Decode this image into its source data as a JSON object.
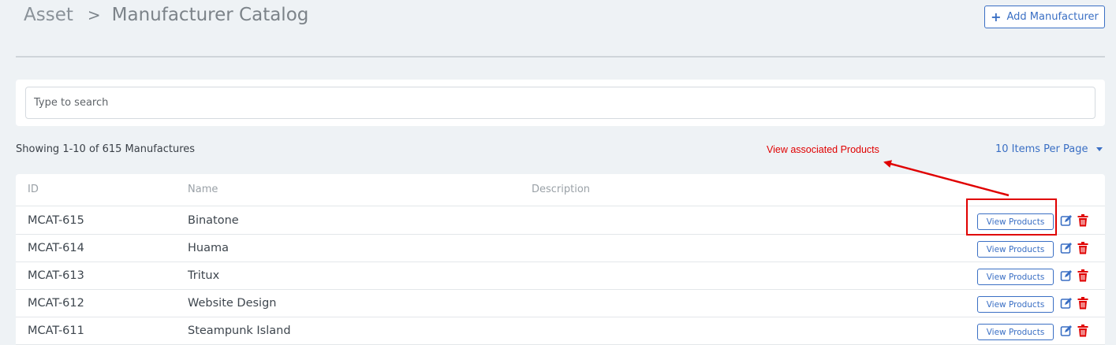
{
  "header": {
    "breadcrumb_root": "Asset",
    "breadcrumb_separator": ">",
    "title": "Manufacturer Catalog",
    "add_button_label": "Add Manufacturer",
    "add_button_icon": "plus-icon"
  },
  "search": {
    "placeholder": "Type to search",
    "value": ""
  },
  "summary": {
    "showing_text": "Showing 1-10 of 615 Manufactures",
    "items_per_page": "10 Items Per Page"
  },
  "annotation": {
    "text": "View associated Products",
    "color": "#e00000"
  },
  "table": {
    "columns": [
      "ID",
      "Name",
      "Description"
    ],
    "rows": [
      {
        "id": "MCAT-615",
        "name": "Binatone",
        "description": "",
        "action_label": "View Products"
      },
      {
        "id": "MCAT-614",
        "name": "Huama",
        "description": "",
        "action_label": "View Products"
      },
      {
        "id": "MCAT-613",
        "name": "Tritux",
        "description": "",
        "action_label": "View Products"
      },
      {
        "id": "MCAT-612",
        "name": "Website Design",
        "description": "",
        "action_label": "View Products"
      },
      {
        "id": "MCAT-611",
        "name": "Steampunk Island",
        "description": "",
        "action_label": "View Products"
      }
    ],
    "row_icons": [
      "edit-icon",
      "trash-icon"
    ]
  },
  "colors": {
    "accent": "#3a6fc4",
    "danger": "#e00000",
    "background": "#eef2f5"
  }
}
